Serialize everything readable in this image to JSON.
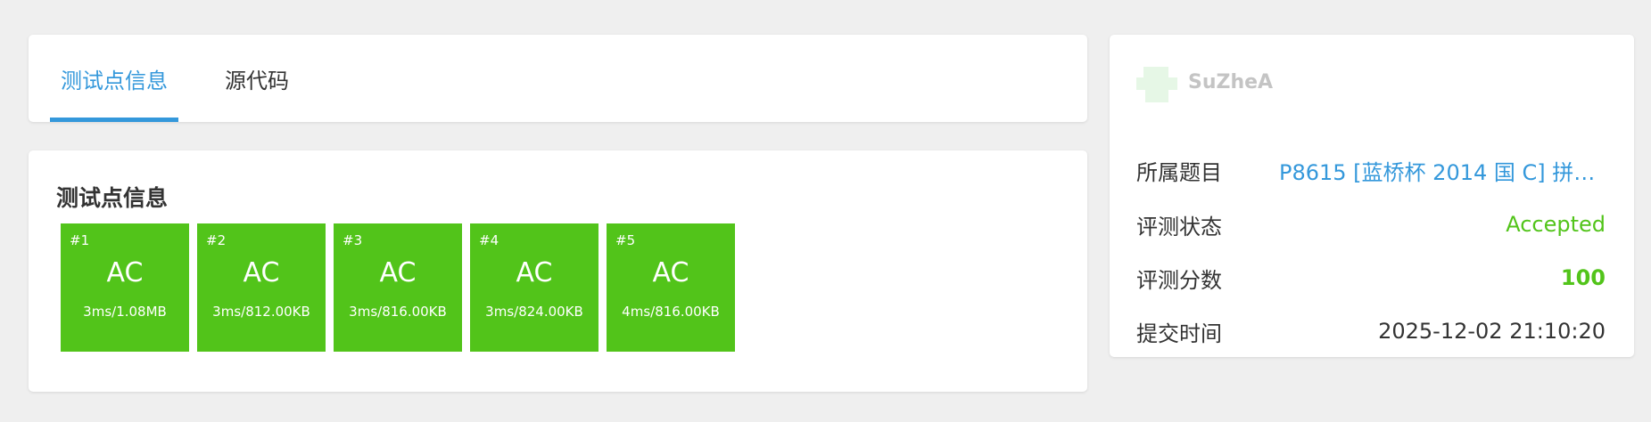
{
  "tabs": [
    {
      "label": "测试点信息",
      "active": true
    },
    {
      "label": "源代码",
      "active": false
    }
  ],
  "testcases": {
    "title": "测试点信息",
    "items": [
      {
        "id": "#1",
        "status": "AC",
        "metric": "3ms/1.08MB"
      },
      {
        "id": "#2",
        "status": "AC",
        "metric": "3ms/812.00KB"
      },
      {
        "id": "#3",
        "status": "AC",
        "metric": "3ms/816.00KB"
      },
      {
        "id": "#4",
        "status": "AC",
        "metric": "3ms/824.00KB"
      },
      {
        "id": "#5",
        "status": "AC",
        "metric": "4ms/816.00KB"
      }
    ]
  },
  "submission": {
    "username": "SuZheA",
    "problem": {
      "label": "所属题目",
      "value": "P8615 [蓝桥杯 2014 国 C] 拼接..."
    },
    "status": {
      "label": "评测状态",
      "value": "Accepted"
    },
    "score": {
      "label": "评测分数",
      "value": "100"
    },
    "time": {
      "label": "提交时间",
      "value": "2025-12-02 21:10:20"
    }
  },
  "colors": {
    "accent": "#3498db",
    "accepted": "#52c41a",
    "background": "#efefef",
    "card": "#ffffff"
  },
  "icons": {
    "avatar": "user-avatar"
  }
}
